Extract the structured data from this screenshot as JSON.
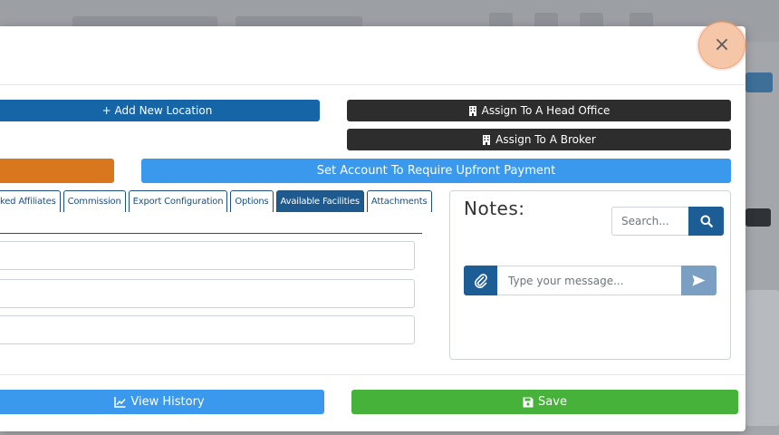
{
  "modal": {
    "close_label": "×",
    "buttons": {
      "add_location": "+ Add New Location",
      "assign_head_office": "Assign To A Head Office",
      "assign_broker": "Assign To A Broker",
      "upfront_payment": "Set Account To Require Upfront Payment",
      "view_history": "View History",
      "save": "Save"
    },
    "tabs": [
      {
        "label": "ked Affiliates",
        "active": false
      },
      {
        "label": "Commission",
        "active": false
      },
      {
        "label": "Export Configuration",
        "active": false
      },
      {
        "label": "Options",
        "active": false
      },
      {
        "label": "Available Facilities",
        "active": true
      },
      {
        "label": "Attachments",
        "active": false
      }
    ],
    "notes": {
      "title": "Notes:",
      "search_placeholder": "Search...",
      "message_placeholder": "Type your message..."
    }
  },
  "icons": {
    "building": "building-icon",
    "history": "line-chart-icon",
    "save": "floppy-disk-icon",
    "search": "search-icon",
    "attach": "paperclip-icon",
    "send": "send-icon",
    "close": "close-icon"
  },
  "colors": {
    "primary_dark": "#1565a7",
    "dark": "#2d2d2d",
    "warning": "#d9771f",
    "info": "#3b99ed",
    "success": "#46b23a"
  }
}
